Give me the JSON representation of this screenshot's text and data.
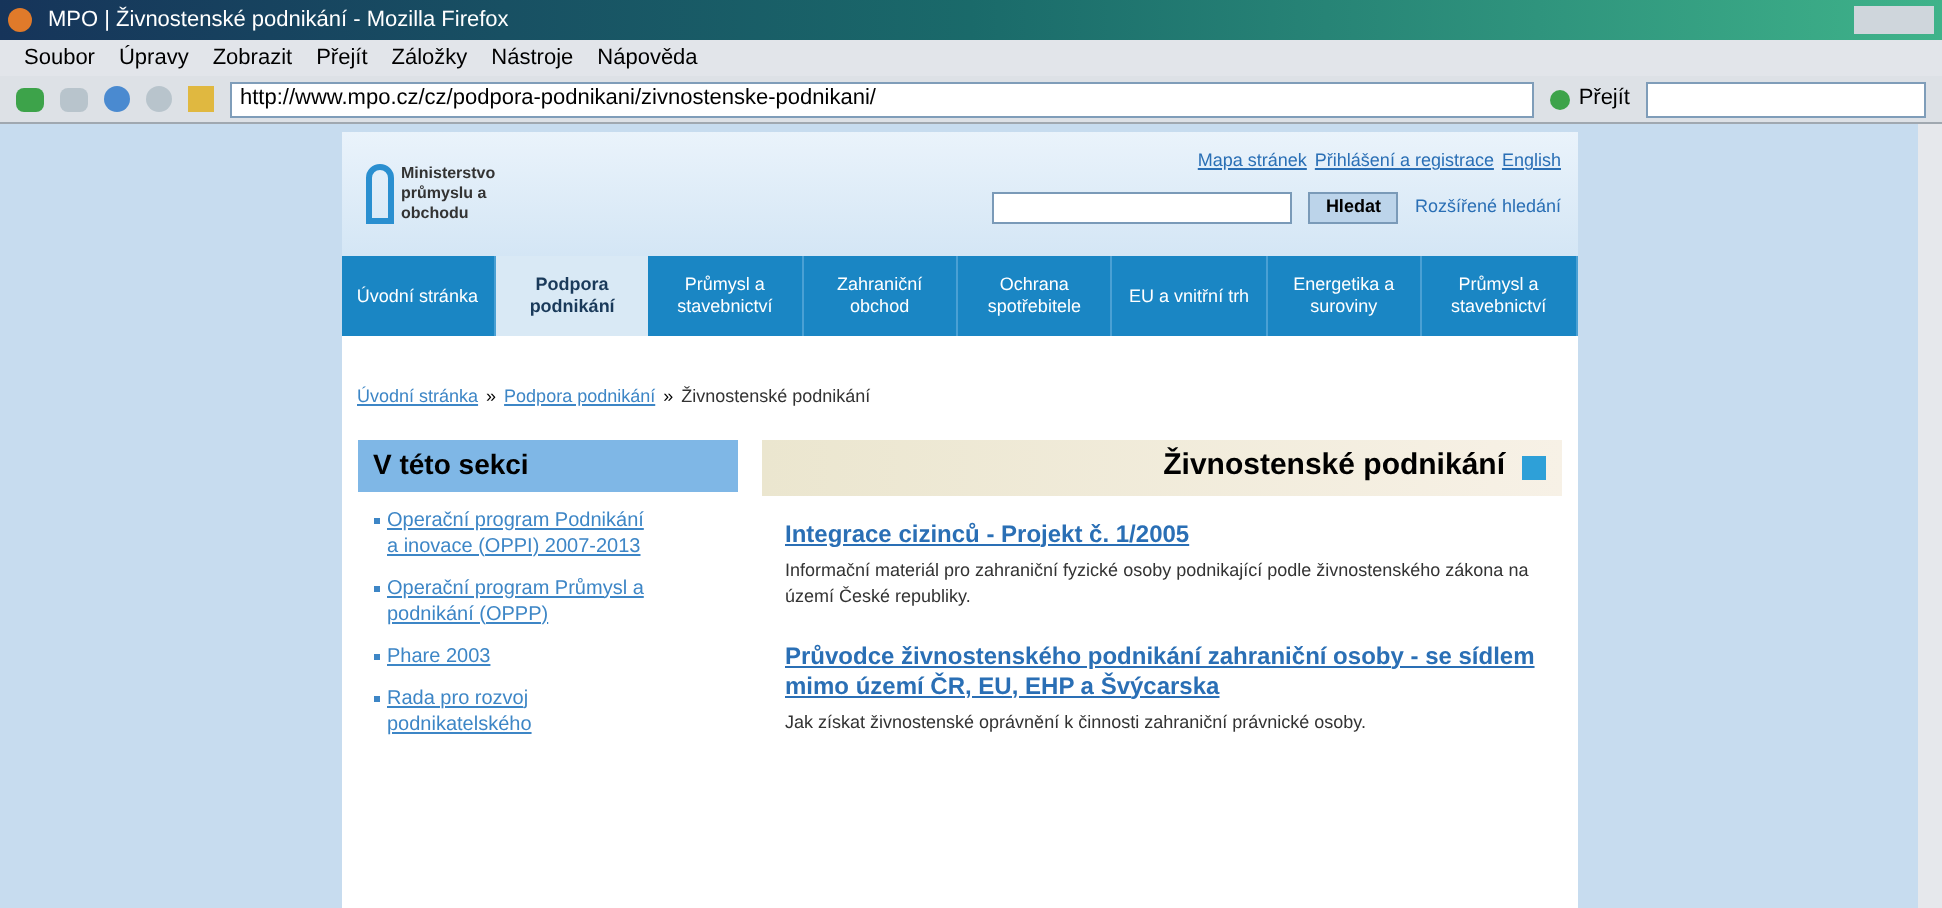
{
  "window": {
    "title": "MPO | Živnostenské podnikání - Mozilla Firefox"
  },
  "menu": [
    "Soubor",
    "Úpravy",
    "Zobrazit",
    "Přejít",
    "Záložky",
    "Nástroje",
    "Nápověda"
  ],
  "address_bar": {
    "value": "http://www.mpo.cz/cz/podpora-podnikani/zivnostenske-podnikani/",
    "go_button": "Přejít"
  },
  "header": {
    "logo_text": "Ministerstvo průmyslu a obchodu",
    "top_links": [
      "Mapa stránek",
      "Přihlášení a registrace",
      "English"
    ],
    "search_button": "Hledat",
    "advanced_search": "Rozšířené hledání"
  },
  "nav": [
    {
      "label": "Úvodní stránka",
      "selected": false
    },
    {
      "label": "Podpora podnikání",
      "selected": true
    },
    {
      "label": "Průmysl a stavebnictví",
      "selected": false
    },
    {
      "label": "Zahraniční obchod",
      "selected": false
    },
    {
      "label": "Ochrana spotřebitele",
      "selected": false
    },
    {
      "label": "EU a vnitřní trh",
      "selected": false
    },
    {
      "label": "Energetika a suroviny",
      "selected": false
    },
    {
      "label": "Průmysl a stavebnictví",
      "selected": false
    }
  ],
  "breadcrumb": {
    "separator": "»",
    "items": [
      "Úvodní stránka",
      "Podpora podnikání",
      "Živnostenské podnikání"
    ]
  },
  "sidebar": {
    "title": "V této sekci",
    "items": [
      "Operační program Podnikání a inovace (OPPI) 2007-2013",
      "Operační program Průmysl a podnikání (OPPP)",
      "Phare 2003",
      "Rada pro rozvoj podnikatelského"
    ]
  },
  "main": {
    "title": "Živnostenské podnikání",
    "articles": [
      {
        "title": "Integrace cizinců - Projekt č. 1/2005",
        "text": "Informační materiál pro zahraniční fyzické osoby podnikající podle živnostenského zákona na území České republiky."
      },
      {
        "title": "Průvodce živnostenského podnikání zahraniční osoby - se sídlem mimo území ČR, EU, EHP a Švýcarska",
        "text": "Jak získat živnostenské oprávnění k činnosti zahraniční právnické osoby."
      }
    ]
  }
}
